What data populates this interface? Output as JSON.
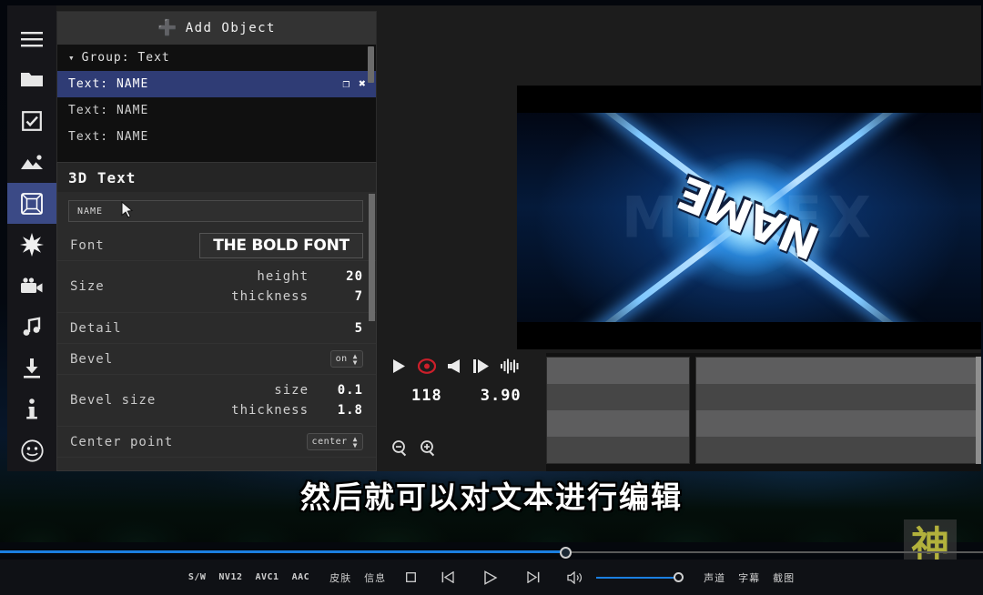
{
  "app": {
    "sidebar": {
      "items": [
        {
          "icon": "hamburger-menu-icon",
          "name": "menu"
        },
        {
          "icon": "folder-icon",
          "name": "projects"
        },
        {
          "icon": "checkbox-icon",
          "name": "tasks"
        },
        {
          "icon": "image-icon",
          "name": "images"
        },
        {
          "icon": "cube-3d-icon",
          "name": "3d-objects",
          "active": true
        },
        {
          "icon": "sparkle-icon",
          "name": "effects"
        },
        {
          "icon": "video-camera-icon",
          "name": "video"
        },
        {
          "icon": "music-note-icon",
          "name": "audio"
        },
        {
          "icon": "download-icon",
          "name": "export"
        },
        {
          "icon": "info-icon",
          "name": "info"
        },
        {
          "icon": "smiley-icon",
          "name": "emoji"
        }
      ]
    },
    "object_panel": {
      "add_button": "Add Object",
      "add_icon": "plus-icon",
      "rows": [
        {
          "label": "Group: Text",
          "type": "group",
          "chevron": "chevron-down-icon"
        },
        {
          "label": "Text: NAME",
          "type": "item",
          "selected": true,
          "actions": [
            "duplicate-icon",
            "close-icon"
          ]
        },
        {
          "label": "Text: NAME",
          "type": "item",
          "selected": false
        },
        {
          "label": "Text: NAME",
          "type": "item",
          "selected": false
        }
      ]
    },
    "properties": {
      "title": "3D Text",
      "text_value": "NAME",
      "font": {
        "label": "Font",
        "value": "THE BOLD FONT"
      },
      "size": {
        "label": "Size",
        "height_label": "height",
        "height": "20",
        "thickness_label": "thickness",
        "thickness": "7"
      },
      "detail": {
        "label": "Detail",
        "value": "5"
      },
      "bevel": {
        "label": "Bevel",
        "value": "on"
      },
      "bevel_size": {
        "label": "Bevel size",
        "size_label": "size",
        "size": "0.1",
        "thickness_label": "thickness",
        "thickness": "1.8"
      },
      "center_point": {
        "label": "Center point",
        "value": "center"
      }
    },
    "preview": {
      "main_text": "NAME",
      "background_watermark": "MIX FX"
    },
    "transport": {
      "icons": [
        "play-icon",
        "record-icon",
        "speaker-icon",
        "frame-advance-icon",
        "waveform-icon"
      ],
      "frame_value": "118",
      "time_value": "3.90",
      "zoom_icons": [
        "zoom-out-icon",
        "zoom-in-icon"
      ]
    }
  },
  "subtitle": "然后就可以对文本进行编辑",
  "watermark": "神",
  "player_bar": {
    "codecs": [
      "S/W",
      "NV12",
      "AVC1",
      "AAC"
    ],
    "skin_label": "皮肤",
    "info_label": "信息",
    "stop_icon": "stop-icon",
    "prev_icon": "previous-icon",
    "play_icon": "play-icon",
    "next_icon": "next-icon",
    "volume_icon": "volume-icon",
    "channel_label": "声道",
    "subtitle_label": "字幕",
    "screenshot_label": "截图"
  },
  "colors": {
    "accent": "#1b7fe0",
    "selection": "#2f3c75",
    "record": "#cc1f2a",
    "watermark": "#b2b13c"
  }
}
